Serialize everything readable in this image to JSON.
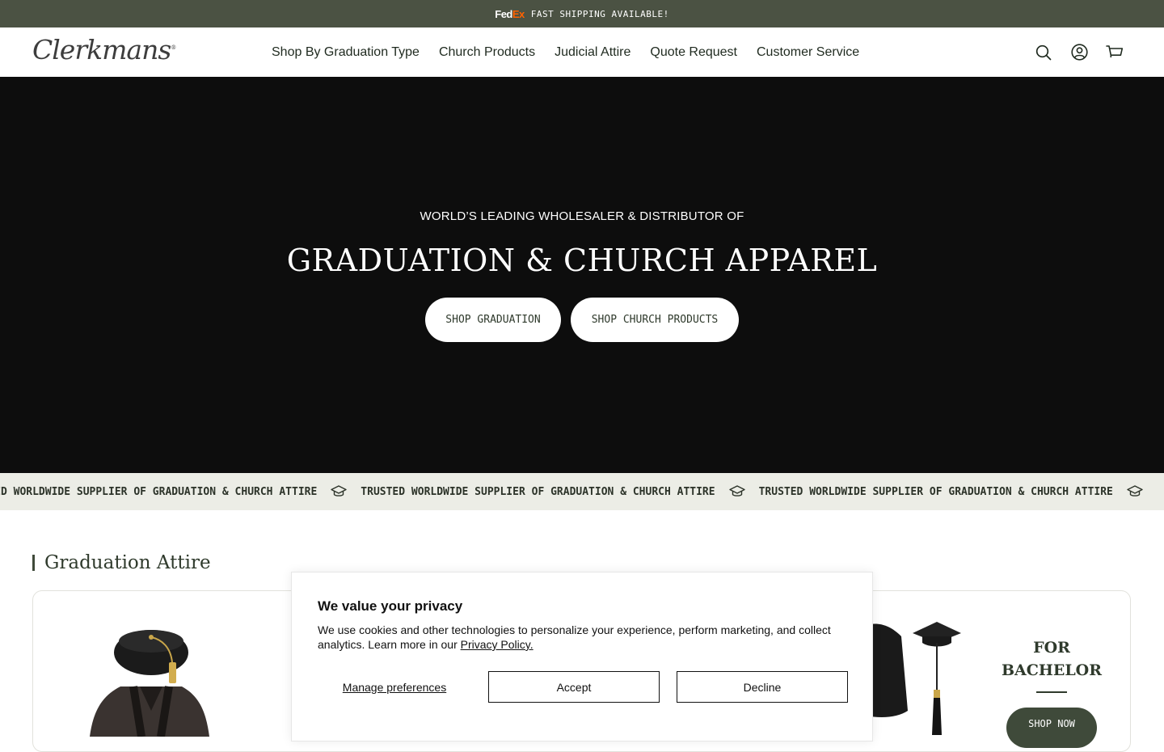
{
  "announcement": {
    "brand_fed": "Fed",
    "brand_ex": "Ex",
    "text": "FAST SHIPPING AVAILABLE!"
  },
  "header": {
    "logo": "Clerkmans",
    "logo_mark": "®",
    "nav": [
      "Shop By Graduation Type",
      "Church Products",
      "Judicial Attire",
      "Quote Request",
      "Customer Service"
    ],
    "icons": [
      "search-icon",
      "account-icon",
      "cart-icon"
    ]
  },
  "hero": {
    "eyebrow": "WORLD’S LEADING WHOLESALER & DISTRIBUTOR OF",
    "title": "GRADUATION & CHURCH APPAREL",
    "buttons": [
      "SHOP GRADUATION",
      "SHOP CHURCH PRODUCTS"
    ]
  },
  "marquee": {
    "text": "TRUSTED WORLDWIDE SUPPLIER OF GRADUATION & CHURCH ATTIRE",
    "icon": "graduation-cap-icon"
  },
  "section": {
    "title": "Graduation Attire"
  },
  "bachelor": {
    "title_line1": "FOR",
    "title_line2": "BACHELOR",
    "button": "SHOP NOW"
  },
  "cookie": {
    "title": "We value your privacy",
    "body": "We use cookies and other technologies to personalize your experience, perform marketing, and collect analytics. Learn more in our ",
    "link": "Privacy Policy.",
    "manage": "Manage preferences",
    "accept": "Accept",
    "decline": "Decline"
  },
  "colors": {
    "announcement_bg": "#4b5243",
    "hero_bg": "#0d0d0d",
    "marquee_bg": "#ecede6",
    "accent_dark_green": "#3f4a3a",
    "fedex_orange": "#ff6200"
  }
}
